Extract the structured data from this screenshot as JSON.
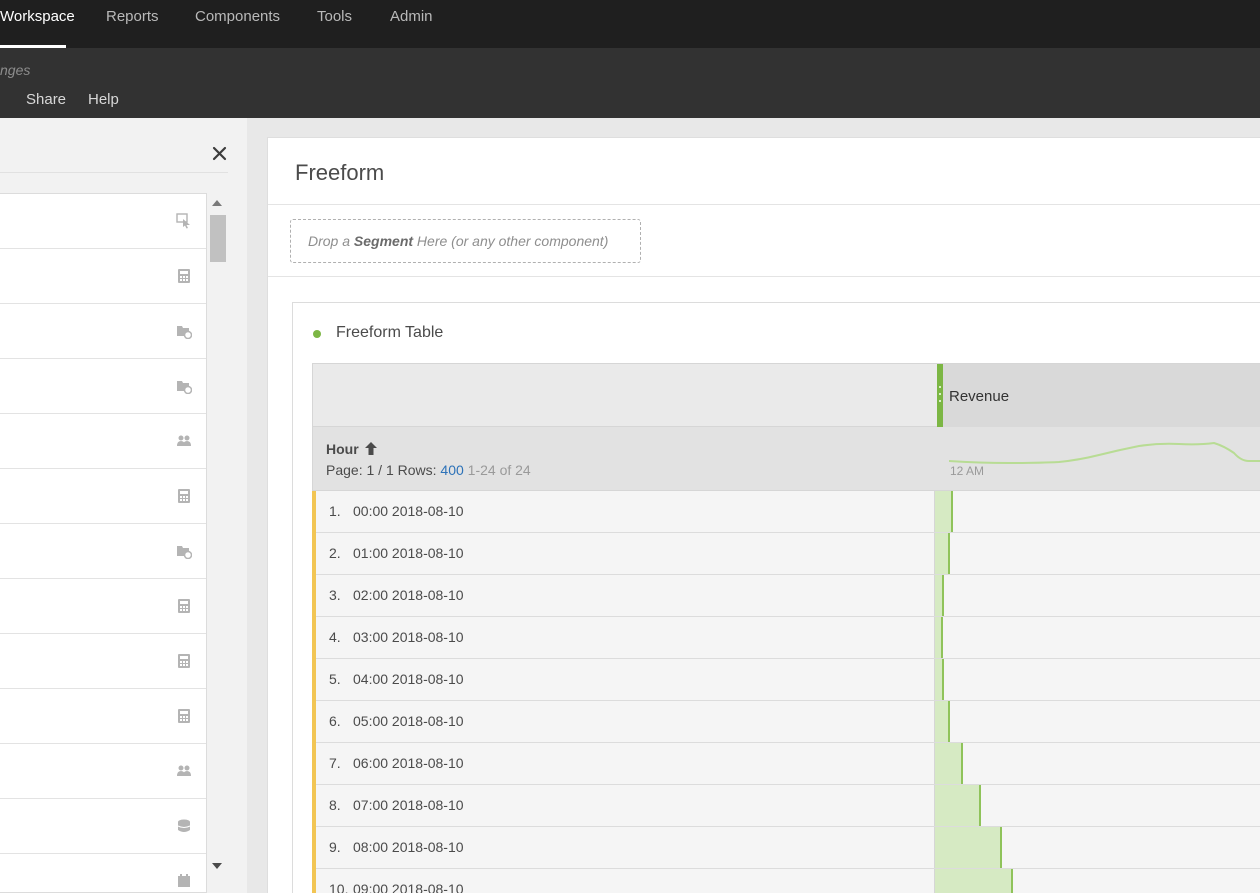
{
  "topnav": {
    "items": [
      "Workspace",
      "Reports",
      "Components",
      "Tools",
      "Admin"
    ],
    "active": "Workspace"
  },
  "subbar": {
    "project_title": "nges",
    "menu": [
      "Share",
      "Help"
    ]
  },
  "left_panel": {
    "close_icon": "close-icon",
    "component_icons": [
      "cursor-icon",
      "calculator-icon",
      "dimension-icon",
      "dimension-icon",
      "segment-icon",
      "calculator-icon",
      "dimension-icon",
      "calculator-icon",
      "calculator-icon",
      "calculator-icon",
      "segment-icon",
      "database-icon",
      "calendar-icon"
    ]
  },
  "panel": {
    "title": "Freeform",
    "dropzone": {
      "prefix": "Drop a ",
      "bold": "Segment",
      "suffix": " Here (or any other component)"
    }
  },
  "visualization": {
    "title": "Freeform Table",
    "dot_color": "#7cb644"
  },
  "table": {
    "metric": "Revenue",
    "dimension": "Hour",
    "page_label": "Page:",
    "page_value": "1 / 1",
    "rows_label": "Rows:",
    "rows_value": "400",
    "range": "1-24 of 24",
    "sparkline_label": "12 AM",
    "rows": [
      {
        "num": "1.",
        "label": "00:00 2018-08-10",
        "bar": 0.055
      },
      {
        "num": "2.",
        "label": "01:00 2018-08-10",
        "bar": 0.045
      },
      {
        "num": "3.",
        "label": "02:00 2018-08-10",
        "bar": 0.027
      },
      {
        "num": "4.",
        "label": "03:00 2018-08-10",
        "bar": 0.024
      },
      {
        "num": "5.",
        "label": "04:00 2018-08-10",
        "bar": 0.027
      },
      {
        "num": "6.",
        "label": "05:00 2018-08-10",
        "bar": 0.045
      },
      {
        "num": "7.",
        "label": "06:00 2018-08-10",
        "bar": 0.084
      },
      {
        "num": "8.",
        "label": "07:00 2018-08-10",
        "bar": 0.14
      },
      {
        "num": "9.",
        "label": "08:00 2018-08-10",
        "bar": 0.203
      },
      {
        "num": "10.",
        "label": "09:00 2018-08-10",
        "bar": 0.237
      }
    ]
  }
}
